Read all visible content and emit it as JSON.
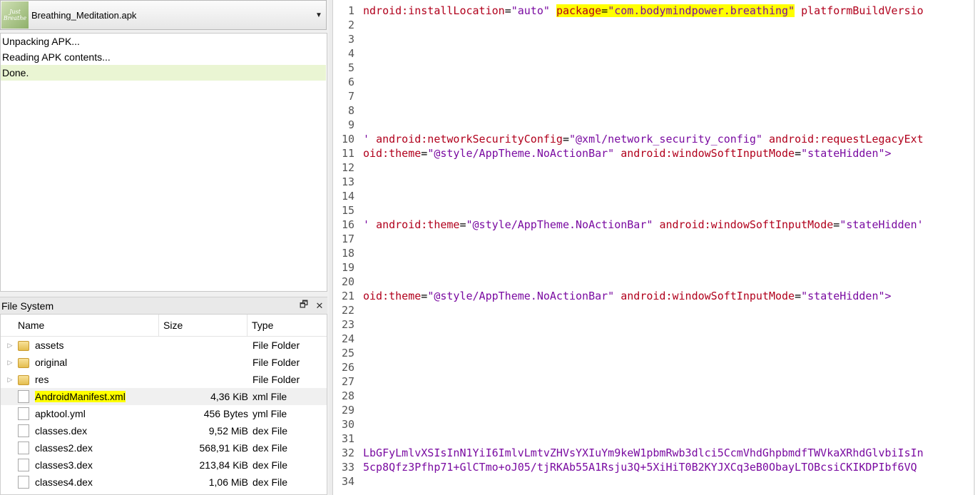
{
  "apk": {
    "name": "Breathing_Meditation.apk",
    "logo_text_top": "Just",
    "logo_text_bottom": "Breathe"
  },
  "log": {
    "lines": [
      "Unpacking APK...",
      "Reading APK contents...",
      "Done."
    ]
  },
  "file_system": {
    "title": "File System",
    "columns": {
      "name": "Name",
      "size": "Size",
      "type": "Type"
    },
    "rows": [
      {
        "name": "assets",
        "size": "",
        "type": "File Folder",
        "kind": "folder"
      },
      {
        "name": "original",
        "size": "",
        "type": "File Folder",
        "kind": "folder"
      },
      {
        "name": "res",
        "size": "",
        "type": "File Folder",
        "kind": "folder"
      },
      {
        "name": "AndroidManifest.xml",
        "size": "4,36 KiB",
        "type": "xml File",
        "kind": "file"
      },
      {
        "name": "apktool.yml",
        "size": "456 Bytes",
        "type": "yml File",
        "kind": "file"
      },
      {
        "name": "classes.dex",
        "size": "9,52 MiB",
        "type": "dex File",
        "kind": "file"
      },
      {
        "name": "classes2.dex",
        "size": "568,91 KiB",
        "type": "dex File",
        "kind": "file"
      },
      {
        "name": "classes3.dex",
        "size": "213,84 KiB",
        "type": "dex File",
        "kind": "file"
      },
      {
        "name": "classes4.dex",
        "size": "1,06 MiB",
        "type": "dex File",
        "kind": "file"
      }
    ]
  },
  "editor": {
    "line_numbers": [
      "1",
      "2",
      "3",
      "4",
      "5",
      "6",
      "7",
      "8",
      "9",
      "10",
      "11",
      "12",
      "13",
      "14",
      "15",
      "16",
      "17",
      "18",
      "19",
      "20",
      "21",
      "22",
      "23",
      "24",
      "25",
      "26",
      "27",
      "28",
      "29",
      "30",
      "31",
      "32",
      "33",
      "34"
    ],
    "line1": {
      "a1": "ndroid:installLocation",
      "v1": "\"auto\"",
      "a2": "package",
      "v2": "\"com.bodymindpower.breathing\"",
      "a3": "platformBuildVersio"
    },
    "line10": {
      "p": "' ",
      "a1": "android:networkSecurityConfig",
      "v1": "\"@xml/network_security_config\"",
      "a2": "android:requestLegacyExt"
    },
    "line11": {
      "a1": "oid:theme",
      "v1": "\"@style/AppTheme.NoActionBar\"",
      "a2": "android:windowSoftInputMode",
      "v2": "\"stateHidden\"",
      "tail": ">"
    },
    "line16": {
      "p": "' ",
      "a1": "android:theme",
      "v1": "\"@style/AppTheme.NoActionBar\"",
      "a2": "android:windowSoftInputMode",
      "v2": "\"stateHidden'"
    },
    "line21": {
      "a1": "oid:theme",
      "v1": "\"@style/AppTheme.NoActionBar\"",
      "a2": "android:windowSoftInputMode",
      "v2": "\"stateHidden\"",
      "tail": ">"
    },
    "line32": "LbGFyLmlvXSIsInN1YiI6ImlvLmtvZHVsYXIuYm9keW1pbmRwb3dlci5CcmVhdGhpbmdfTWVkaXRhdGlvbiIsIn",
    "line33": "5cp8Qfz3Pfhp71+GlCTmo+oJ05/tjRKAb55A1Rsju3Q+5XiHiT0B2KYJXCq3eB0ObayLTOBcsiCKIKDPIbf6VQ"
  }
}
